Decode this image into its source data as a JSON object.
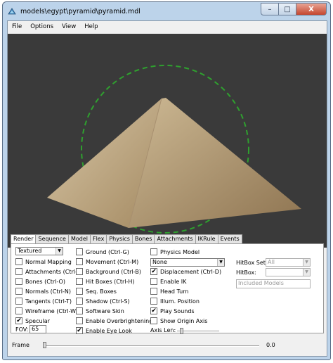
{
  "window": {
    "title": "models\\egypt\\pyramid\\pyramid.mdl",
    "minimize_glyph": "–",
    "maximize_glyph": "□",
    "close_glyph": "X"
  },
  "menu": [
    "File",
    "Options",
    "View",
    "Help"
  ],
  "tabs": [
    "Render",
    "Sequence",
    "Model",
    "Flex",
    "Physics",
    "Bones",
    "Attachments",
    "IKRule",
    "Events"
  ],
  "render": {
    "render_mode": "Textured",
    "col1": [
      {
        "label": "Normal Mapping",
        "checked": false
      },
      {
        "label": "Attachments (Ctrl-A)",
        "checked": false
      },
      {
        "label": "Bones (Ctrl-O)",
        "checked": false
      },
      {
        "label": "Normals (Ctrl-N)",
        "checked": false
      },
      {
        "label": "Tangents (Ctrl-T)",
        "checked": false
      },
      {
        "label": "Wireframe (Ctrl-W)",
        "checked": false
      },
      {
        "label": "Specular",
        "checked": true
      }
    ],
    "fov_label": "FOV:",
    "fov_value": "65",
    "col2": [
      {
        "label": "Ground (Ctrl-G)",
        "checked": false
      },
      {
        "label": "Movement (Ctrl-M)",
        "checked": false
      },
      {
        "label": "Background (Ctrl-B)",
        "checked": false
      },
      {
        "label": "Hit Boxes (Ctrl-H)",
        "checked": false
      },
      {
        "label": "Seq. Boxes",
        "checked": false
      },
      {
        "label": "Shadow (Ctrl-S)",
        "checked": false
      },
      {
        "label": "Software Skin",
        "checked": false
      },
      {
        "label": "Enable Overbrightening",
        "checked": false
      },
      {
        "label": "Enable Eye Look",
        "checked": true
      }
    ],
    "physics_model": {
      "label": "Physics Model",
      "checked": false
    },
    "physics_select": "None",
    "col3": [
      {
        "label": "Displacement (Ctrl-D)",
        "checked": true
      },
      {
        "label": "Enable IK",
        "checked": false
      },
      {
        "label": "Head Turn",
        "checked": false
      },
      {
        "label": "Illum. Position",
        "checked": false
      },
      {
        "label": "Play Sounds",
        "checked": true
      },
      {
        "label": "Show Origin Axis",
        "checked": false
      }
    ],
    "axis_len_label": "Axis Len:",
    "axis_len_level": 0.1,
    "hitbox_set_label": "HitBox Set:",
    "hitbox_set_value": "All",
    "hitbox_label": "HitBox:",
    "hitbox_value": "",
    "included_models": "Included Models"
  },
  "frame": {
    "label": "Frame",
    "value": "0.0",
    "position": 0.0
  },
  "colors": {
    "viewport_bg": "#3a3a3a",
    "circle": "#2fa02f",
    "pyramid_light": "#d4c3a3",
    "pyramid_dark": "#8a7150"
  }
}
